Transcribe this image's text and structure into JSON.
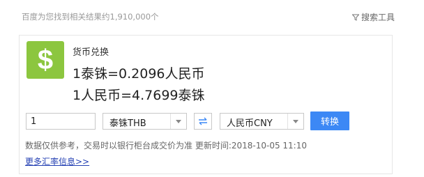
{
  "header": {
    "result_count": "百度为您找到相关结果约1,910,000个",
    "search_tools": "搜索工具",
    "search_tools_icon": "filter-icon"
  },
  "card": {
    "logo_icon": "dollar-sign-icon",
    "logo_glyph": "$",
    "title": "货币兑换",
    "rate_forward": "1泰铢=0.2096人民币",
    "rate_reverse": "1人民币=4.7699泰铢"
  },
  "converter": {
    "amount_value": "1",
    "from_currency": "泰铢THB",
    "to_currency": "人民币CNY",
    "swap_icon": "swap-arrows-icon",
    "convert_label": "转换"
  },
  "footer": {
    "disclaimer": "数据仅供参考，交易时以银行柜台成交价为准 更新时间:2018-10-05 11:10",
    "more_link": "更多汇率信息>>"
  },
  "colors": {
    "logo_green": "#8cc63f",
    "button_blue": "#3c88f5",
    "link_blue": "#2440b3"
  }
}
